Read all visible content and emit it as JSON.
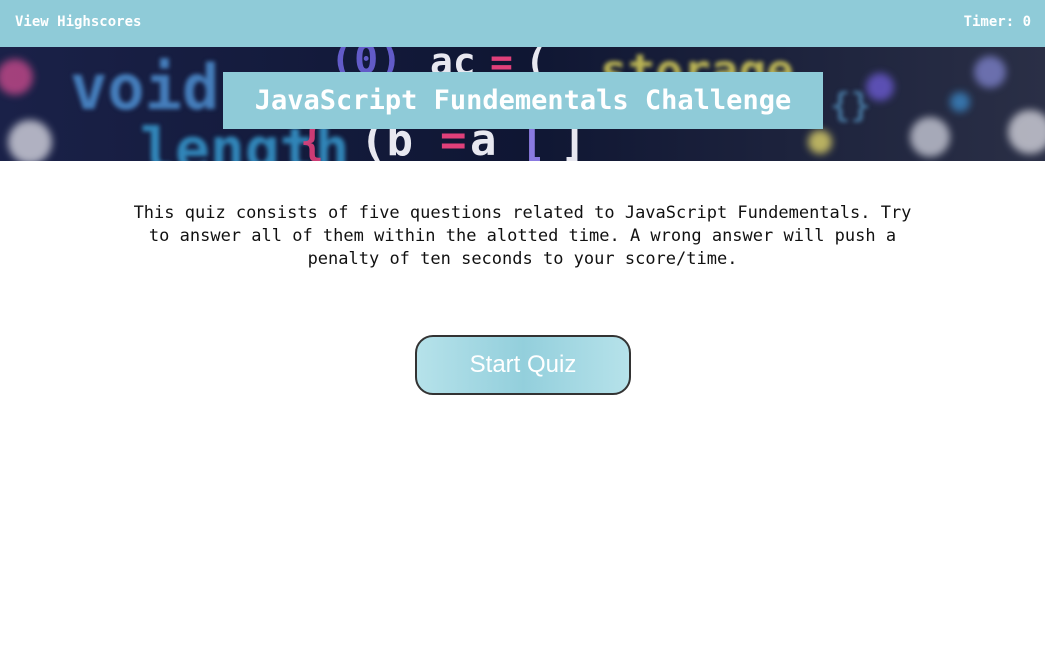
{
  "header": {
    "highscores_label": "View Highscores",
    "timer_text": "Timer: 0"
  },
  "hero": {
    "title": "JavaScript Fundementals Challenge"
  },
  "intro": {
    "text": "This quiz consists of five questions related to JavaScript Fundementals. Try to answer all of them within the alotted time. A wrong answer will push a penalty of ten seconds to your score/time."
  },
  "actions": {
    "start_label": "Start Quiz"
  },
  "colors": {
    "accent": "#8fcbd8",
    "banner_bg": "#121a3a",
    "text": "#111111"
  }
}
